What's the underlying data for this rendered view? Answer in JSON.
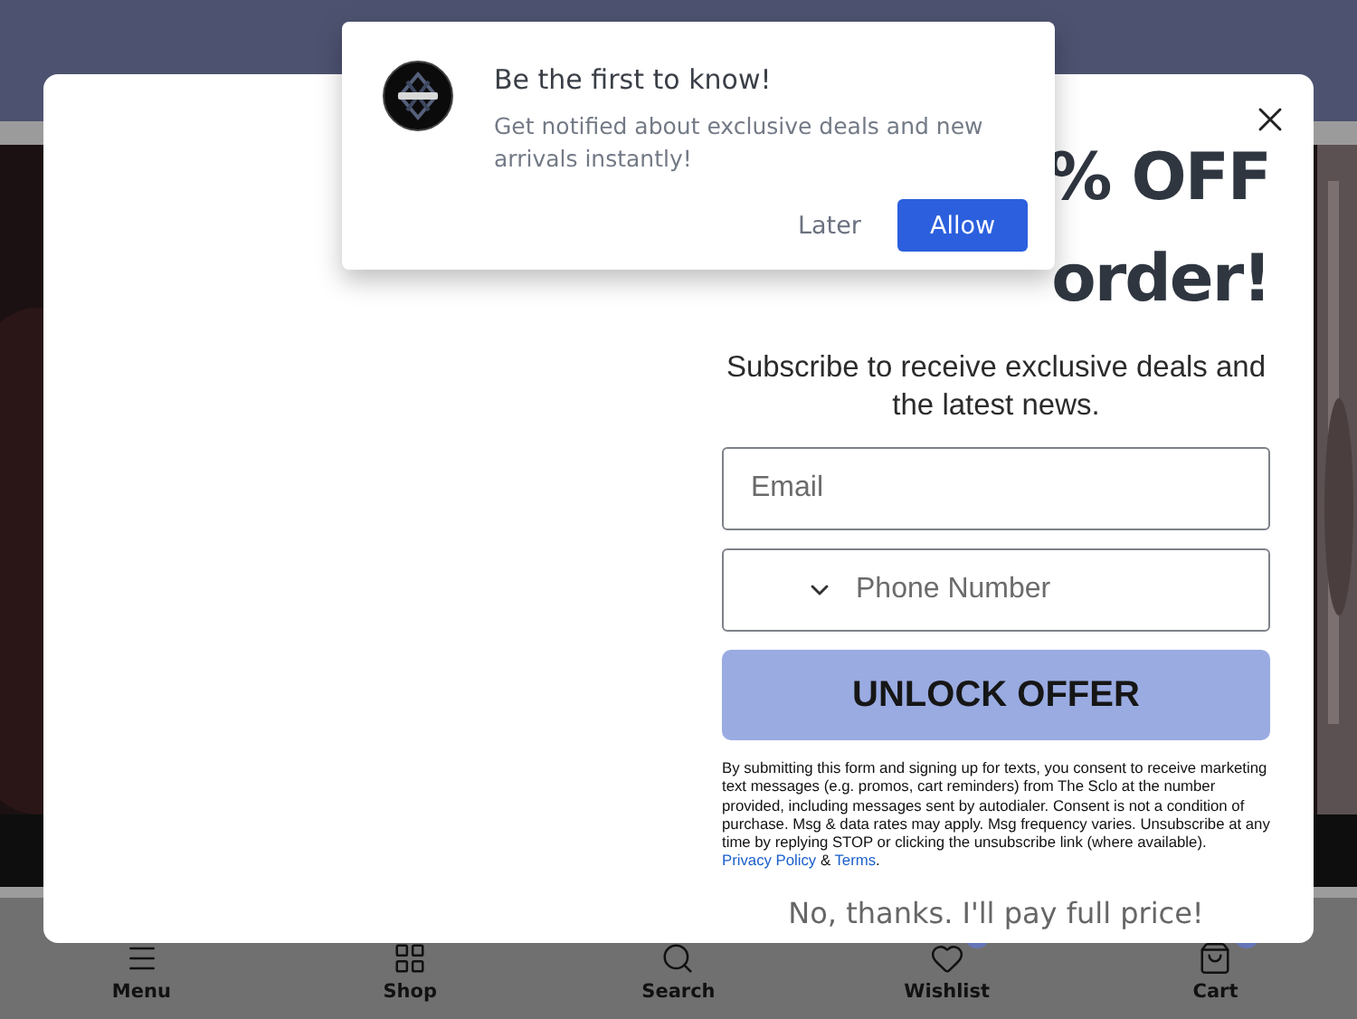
{
  "notification": {
    "title": "Be the first to know!",
    "body": "Get notified about exclusive deals and new arrivals instantly!",
    "buttons": [
      {
        "label": "Later",
        "primary": false
      },
      {
        "label": "Allow",
        "primary": true
      }
    ]
  },
  "popup": {
    "headline": [
      "% OFF",
      "order!"
    ],
    "subtitle": "Subscribe to receive exclusive deals and the latest news.",
    "email": {
      "placeholder": "Email"
    },
    "phone": {
      "placeholder": "Phone Number"
    },
    "submit": "UNLOCK OFFER",
    "disclaimer": "By submitting this form and signing up for texts, you consent to receive marketing text messages (e.g. promos, cart reminders) from The Sclo at the number provided, including messages sent by autodialer. Consent is not a condition of purchase. Msg & data rates may apply. Msg frequency varies. Unsubscribe at any time by replying STOP or clicking the unsubscribe link (where available).",
    "links": [
      "Privacy Policy",
      "Terms"
    ],
    "link_joiner": "&",
    "disclaimer_end": ".",
    "decline": "No, thanks. I'll pay full price!"
  },
  "bottom_nav": [
    {
      "label": "Menu",
      "badge": false
    },
    {
      "label": "Shop",
      "badge": false
    },
    {
      "label": "Search",
      "badge": false
    },
    {
      "label": "Wishlist",
      "badge": true
    },
    {
      "label": "Cart",
      "badge": true
    }
  ]
}
